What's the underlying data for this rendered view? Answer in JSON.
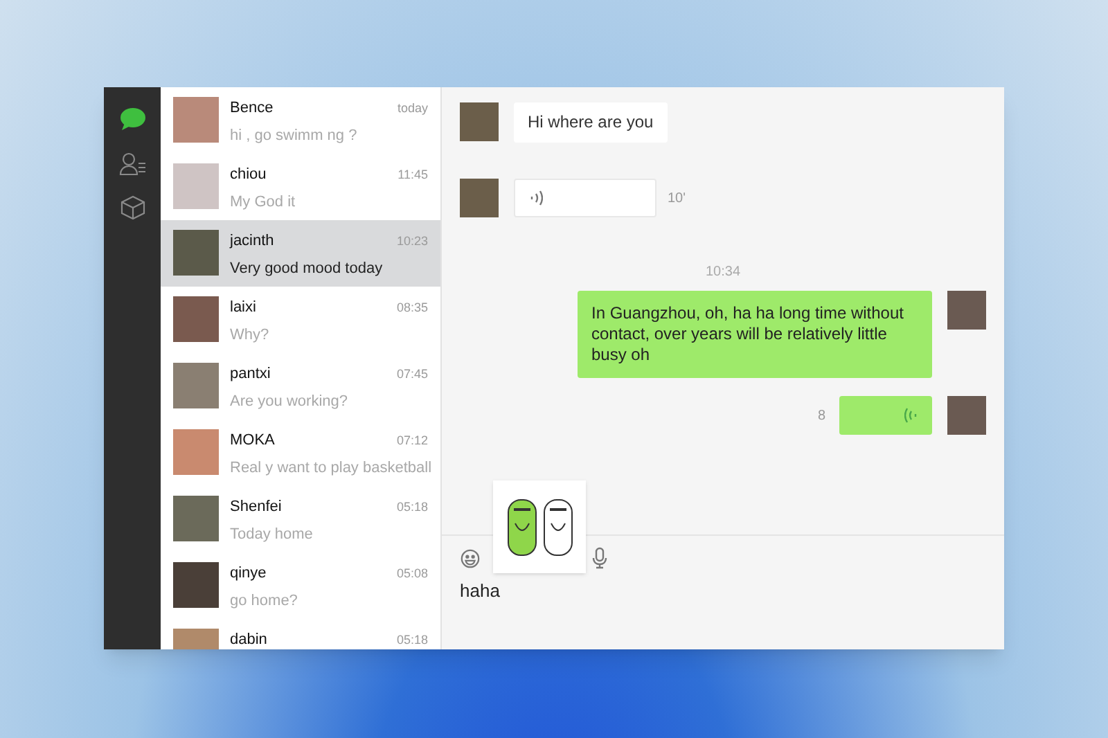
{
  "sidebar": {
    "items": [
      {
        "kind": "chat",
        "selected": true
      },
      {
        "kind": "contacts",
        "selected": false
      },
      {
        "kind": "box",
        "selected": false
      }
    ]
  },
  "chats": [
    {
      "name": "Bence",
      "time": "today",
      "preview": "hi , go swimm ng ?",
      "selected": false
    },
    {
      "name": "chiou",
      "time": "11:45",
      "preview": "My God it",
      "selected": false
    },
    {
      "name": "jacinth",
      "time": "10:23",
      "preview": "Very good mood today",
      "selected": true
    },
    {
      "name": "laixi",
      "time": "08:35",
      "preview": "Why?",
      "selected": false
    },
    {
      "name": "pantxi",
      "time": "07:45",
      "preview": "Are you working?",
      "selected": false
    },
    {
      "name": "MOKA",
      "time": "07:12",
      "preview": "Real y want to play basketball",
      "selected": false
    },
    {
      "name": "Shenfei",
      "time": "05:18",
      "preview": "Today home",
      "selected": false
    },
    {
      "name": "qinye",
      "time": "05:08",
      "preview": "go home?",
      "selected": false
    },
    {
      "name": "dabin",
      "time": "05:18",
      "selected": false
    }
  ],
  "messages": [
    {
      "kind": "text",
      "outgoing": false,
      "text": "Hi where are you"
    },
    {
      "kind": "voice",
      "outgoing": false,
      "duration": "10'"
    },
    {
      "kind": "time",
      "text": "10:34"
    },
    {
      "kind": "text",
      "outgoing": true,
      "text": "In Guangzhou, oh, ha ha long time without contact, over years will be relatively little busy oh"
    },
    {
      "kind": "voice",
      "outgoing": true,
      "duration": "8"
    }
  ],
  "composer": {
    "value": "haha"
  }
}
